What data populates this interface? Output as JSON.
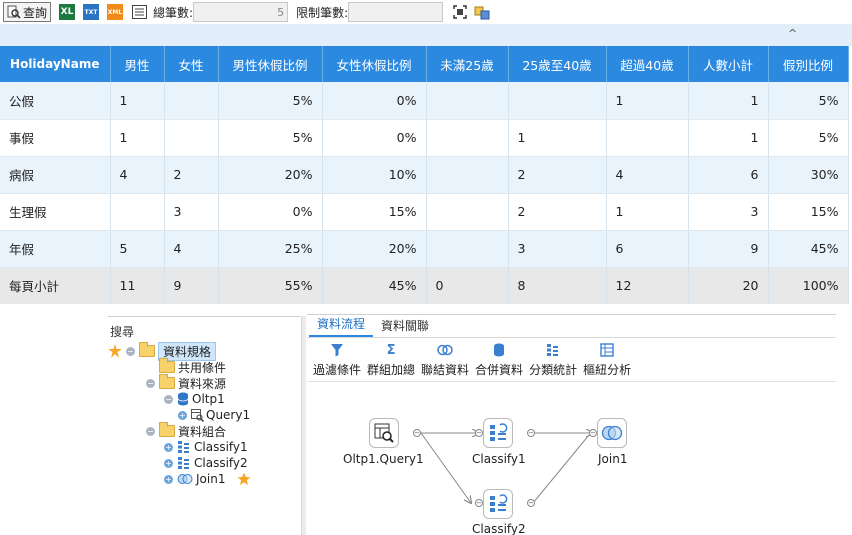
{
  "toolbar": {
    "query_label": "查詢",
    "excel_icon": "XL",
    "txt_icon": "TXT",
    "xml_icon": "XML",
    "total_count_label": "總筆數:",
    "total_count_value": "5",
    "limit_label": "限制筆數:",
    "limit_value": ""
  },
  "grid": {
    "columns": [
      "HolidayName",
      "男性",
      "女性",
      "男性休假比例",
      "女性休假比例",
      "未滿25歲",
      "25歲至40歲",
      "超過40歲",
      "人數小計",
      "假別比例"
    ],
    "rows": [
      [
        "公假",
        "1",
        "",
        "5%",
        "0%",
        "",
        "",
        "1",
        "1",
        "5%"
      ],
      [
        "事假",
        "1",
        "",
        "5%",
        "0%",
        "",
        "1",
        "",
        "1",
        "5%"
      ],
      [
        "病假",
        "4",
        "2",
        "20%",
        "10%",
        "",
        "2",
        "4",
        "6",
        "30%"
      ],
      [
        "生理假",
        "",
        "3",
        "0%",
        "15%",
        "",
        "2",
        "1",
        "3",
        "15%"
      ],
      [
        "年假",
        "5",
        "4",
        "25%",
        "20%",
        "",
        "3",
        "6",
        "9",
        "45%"
      ]
    ],
    "subtotal": [
      "每頁小計",
      "11",
      "9",
      "55%",
      "45%",
      "0",
      "8",
      "12",
      "20",
      "100%"
    ]
  },
  "tree": {
    "search_label": "搜尋",
    "root": "資料規格",
    "common": "共用條件",
    "source": "資料來源",
    "oltp": "Oltp1",
    "query": "Query1",
    "combine": "資料組合",
    "classify1": "Classify1",
    "classify2": "Classify2",
    "join1": "Join1"
  },
  "flow": {
    "tabs": [
      "資料流程",
      "資料關聯"
    ],
    "tools": [
      "過濾條件",
      "群組加總",
      "聯結資料",
      "合併資料",
      "分類統計",
      "樞紐分析"
    ],
    "nodes": {
      "query": "Oltp1.Query1",
      "classify1": "Classify1",
      "join1": "Join1",
      "classify2": "Classify2"
    }
  },
  "colors": {
    "header_blue": "#2b8ae0",
    "row_tint": "#e8f3fc",
    "subtotal_gray": "#e8e8e8"
  }
}
